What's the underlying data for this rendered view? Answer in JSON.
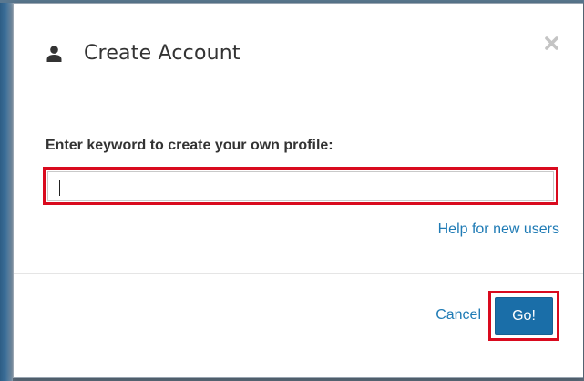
{
  "dialog": {
    "title": "Create Account",
    "header_icon": "user-icon",
    "close_icon": "close-icon"
  },
  "form": {
    "keyword_label": "Enter keyword to create your own profile:",
    "keyword_value": "",
    "keyword_placeholder": "",
    "help_link": "Help for new users"
  },
  "footer": {
    "cancel_label": "Cancel",
    "go_label": "Go!"
  },
  "colors": {
    "primary_button": "#1a6ea8",
    "link": "#1f7bb5",
    "highlight_border": "#d90a1e"
  }
}
